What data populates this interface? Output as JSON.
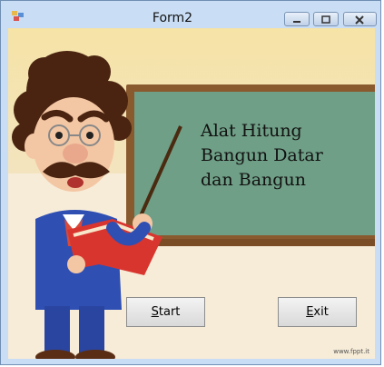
{
  "window": {
    "title": "Form2"
  },
  "board": {
    "lines": [
      "Alat Hitung",
      "Bangun Datar",
      "dan Bangun"
    ]
  },
  "buttons": {
    "start": {
      "mnemonic": "S",
      "rest": "tart"
    },
    "exit": {
      "mnemonic": "E",
      "rest": "xit"
    }
  },
  "watermark": "www.fppt.it",
  "colors": {
    "board": "#6f9f86",
    "frame": "#8a5a2f",
    "titlebar": "#c9def5"
  }
}
